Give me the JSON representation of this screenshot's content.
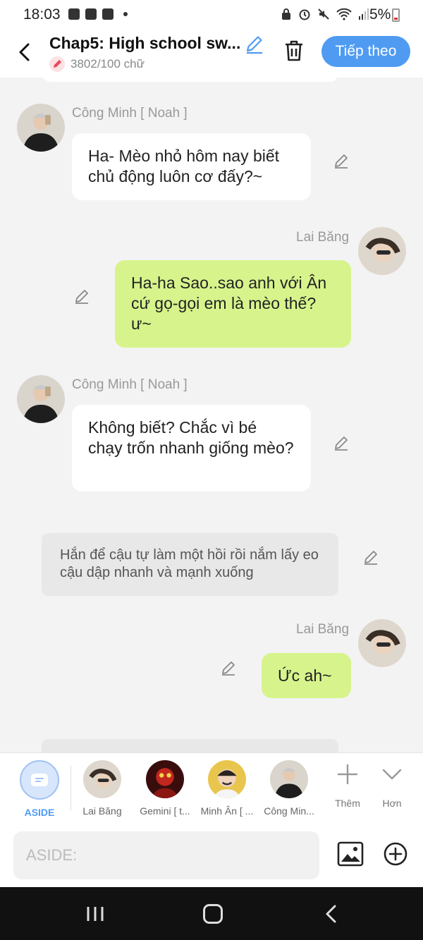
{
  "status_bar": {
    "time": "18:03",
    "battery": "5%"
  },
  "header": {
    "title": "Chap5: High school sw...",
    "word_count": "3802/100 chữ",
    "next_button": "Tiếp theo"
  },
  "messages": [
    {
      "side": "left",
      "name": "Công Minh [ Noah ]",
      "text": "Ha- Mèo nhỏ hôm nay biết chủ động luôn cơ đấy?~"
    },
    {
      "side": "right",
      "name": "Lai Băng",
      "text": "Ha-ha Sao..sao anh với Ân cứ gọ-gọi em là mèo thế? ư~"
    },
    {
      "side": "left",
      "name": "Công Minh [ Noah ]",
      "text": "Không biết? Chắc vì bé chạy trốn nhanh giống mèo?"
    },
    {
      "side": "narration",
      "text": "Hắn để cậu tự làm một hồi rồi nắm lấy eo cậu dập nhanh và mạnh xuống"
    },
    {
      "side": "right",
      "name": "Lai Băng",
      "text": "Ức ah~"
    }
  ],
  "characters": [
    {
      "label": "ASIDE"
    },
    {
      "label": "Lai Băng"
    },
    {
      "label": "Gemini [ t..."
    },
    {
      "label": "Minh Ân [ ..."
    },
    {
      "label": "Công Min..."
    }
  ],
  "tools": {
    "more_label": "Thêm",
    "expand_label": "Hơn"
  },
  "input": {
    "placeholder": "ASIDE:"
  },
  "colors": {
    "accent": "#4f9bf2",
    "my_bubble": "#d7f48c",
    "aside_label": "#4f9bf2"
  }
}
